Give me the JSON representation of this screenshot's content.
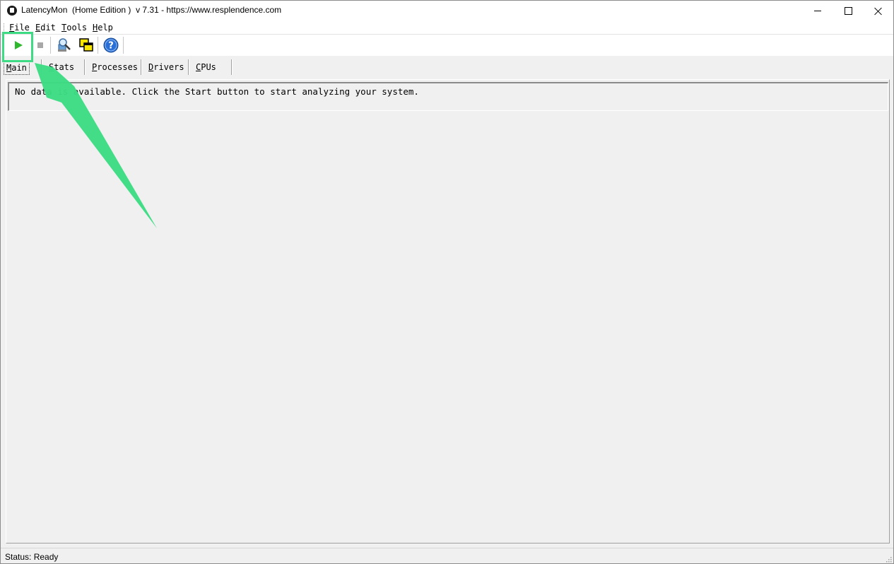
{
  "window": {
    "title": "LatencyMon  (Home Edition )  v 7.31 - https://www.resplendence.com"
  },
  "menu": {
    "items": [
      {
        "label": "File",
        "mnemonic": "F"
      },
      {
        "label": "Edit",
        "mnemonic": "E"
      },
      {
        "label": "Tools",
        "mnemonic": "T"
      },
      {
        "label": "Help",
        "mnemonic": "H"
      }
    ]
  },
  "toolbar": {
    "buttons": [
      {
        "name": "start",
        "icon": "play-icon",
        "color": "#2db82d"
      },
      {
        "name": "stop",
        "icon": "stop-icon",
        "color": "#a8a8a8"
      },
      {
        "name": "analyze",
        "icon": "magnifier-icon"
      },
      {
        "name": "window",
        "icon": "window-icon"
      },
      {
        "name": "help",
        "icon": "help-icon",
        "color": "#2a6fd6"
      }
    ]
  },
  "tabs": {
    "items": [
      {
        "label": "Main",
        "mnemonic": "M",
        "active": true
      },
      {
        "label": "Stats",
        "mnemonic": "S",
        "active": false
      },
      {
        "label": "Processes",
        "mnemonic": "P",
        "active": false
      },
      {
        "label": "Drivers",
        "mnemonic": "D",
        "active": false
      },
      {
        "label": "CPUs",
        "mnemonic": "C",
        "active": false
      }
    ]
  },
  "main": {
    "message": "No data is available. Click the Start button to start analyzing your system."
  },
  "status": {
    "text": "Status: Ready"
  },
  "annotation": {
    "color": "#3ddc84",
    "target": "start-button"
  }
}
